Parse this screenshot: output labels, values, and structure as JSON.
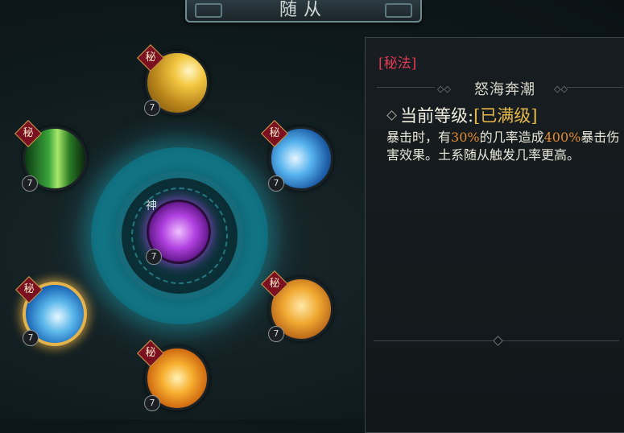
{
  "header": {
    "title": "随从"
  },
  "skills": [
    {
      "id": "top",
      "tag": "秘",
      "level": "7"
    },
    {
      "id": "left",
      "tag": "秘",
      "level": "7"
    },
    {
      "id": "right",
      "tag": "秘",
      "level": "7"
    },
    {
      "id": "center",
      "tag": "神",
      "level": "7"
    },
    {
      "id": "wave",
      "tag": "秘",
      "level": "7"
    },
    {
      "id": "eagle",
      "tag": "秘",
      "level": "7"
    },
    {
      "id": "bottom",
      "tag": "秘",
      "level": "7"
    }
  ],
  "detail": {
    "category": "[秘法]",
    "name": "怒海奔潮",
    "level_label": "当前等级:",
    "level_value": "[已满级]",
    "desc_1": "暴击时，有",
    "desc_pct1": "30%",
    "desc_2": "的几率造成",
    "desc_pct2": "400%",
    "desc_3": "暴击伤害效果。土系随从触发几率更高。"
  },
  "colors": {
    "category": "#e23a52",
    "level_value": "#e7b84a",
    "highlight": "#e58a2e",
    "ring_glow": "#1592a6"
  }
}
